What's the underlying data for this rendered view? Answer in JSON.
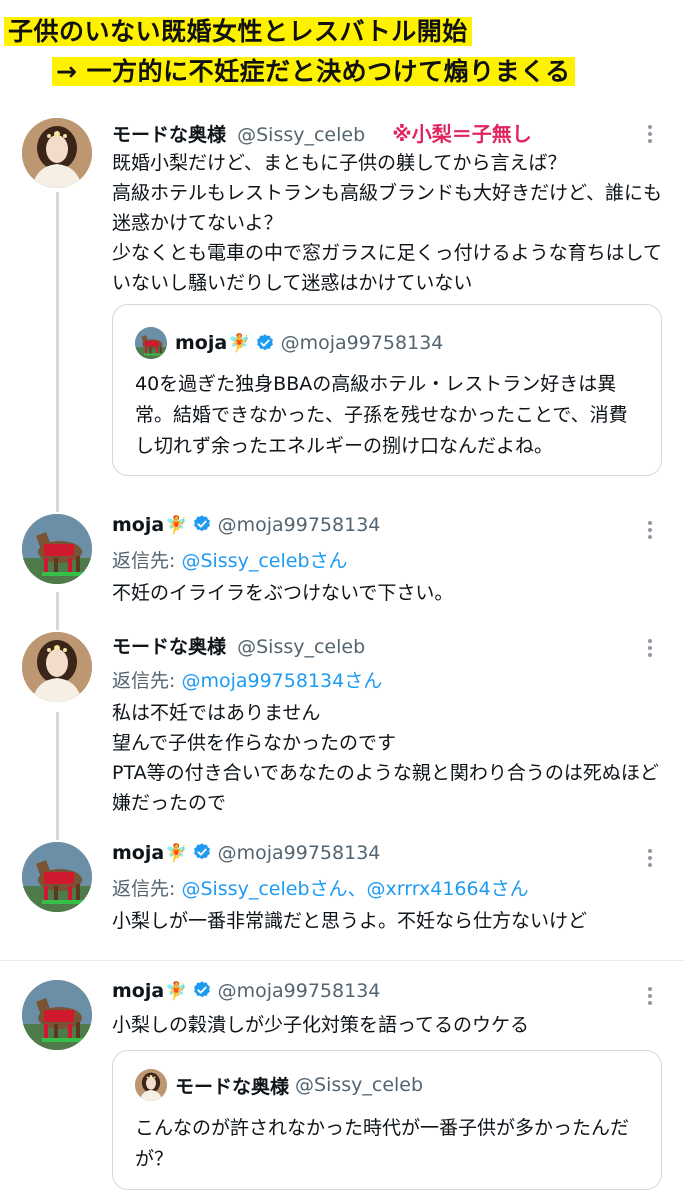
{
  "banner": {
    "line1": "子供のいない既婚女性とレスバトル開始",
    "line2": "→ 一方的に不妊症だと決めつけて煽りまくる"
  },
  "colors": {
    "banner_highlight": "#fff200",
    "link": "#1d9bf0",
    "note": "#e0245e"
  },
  "tweets": [
    {
      "name": "モードな奥様",
      "handle": "@Sissy_celeb",
      "note": "※小梨＝子無し",
      "body": "既婚小梨だけど、まともに子供の躾してから言えば？\n高級ホテルもレストランも高級ブランドも大好きだけど、誰にも迷惑かけてないよ？\n少なくとも電車の中で窓ガラスに足くっ付けるような育ちはしていないし騒いだりして迷惑はかけていない",
      "quote": {
        "name": "moja",
        "handle": "@moja99758134",
        "text": "40を過ぎた独身BBAの高級ホテル・レストラン好きは異常。結婚できなかった、子孫を残せなかったことで、消費し切れず余ったエネルギーの捌け口なんだよね。"
      }
    },
    {
      "name": "moja",
      "handle": "@moja99758134",
      "replyto_prefix": "返信先: ",
      "replyto_link": "@Sissy_celebさん",
      "body": "不妊のイライラをぶつけないで下さい。"
    },
    {
      "name": "モードな奥様",
      "handle": "@Sissy_celeb",
      "replyto_prefix": "返信先: ",
      "replyto_link": "@moja99758134さん",
      "body": "私は不妊ではありません\n望んで子供を作らなかったのです\nPTA等の付き合いであなたのような親と関わり合うのは死ぬほど嫌だったので"
    },
    {
      "name": "moja",
      "handle": "@moja99758134",
      "replyto_prefix": "返信先: ",
      "replyto_link": "@Sissy_celebさん、@xrrrx41664さん",
      "body": "小梨しが一番非常識だと思うよ。不妊なら仕方ないけど"
    },
    {
      "name": "moja",
      "handle": "@moja99758134",
      "body": "小梨しの穀潰しが少子化対策を語ってるのウケる",
      "quote": {
        "name": "モードな奥様",
        "handle": "@Sissy_celeb",
        "text": "こんなのが許されなかった時代が一番子供が多かったんだが？"
      }
    }
  ]
}
